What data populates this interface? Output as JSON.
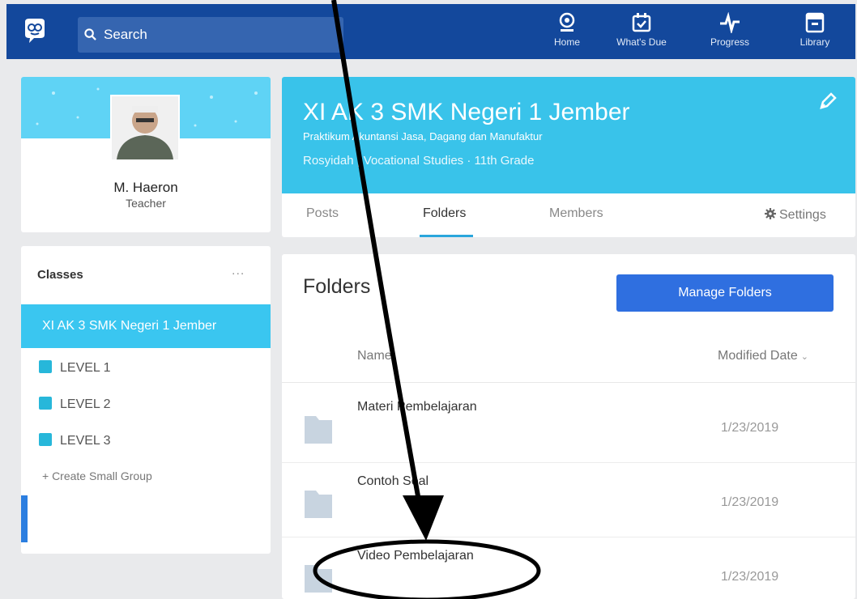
{
  "topbar": {
    "search_placeholder": "Search",
    "nav": [
      {
        "label": "Home",
        "icon": "home-icon"
      },
      {
        "label": "What's Due",
        "icon": "calendar-icon"
      },
      {
        "label": "Progress",
        "icon": "pulse-icon"
      },
      {
        "label": "Library",
        "icon": "library-icon"
      }
    ],
    "bar_color": "#13489c"
  },
  "profile": {
    "name": "M. Haeron",
    "role": "Teacher"
  },
  "classes": {
    "title": "Classes",
    "more": "...",
    "active_class": "XI AK 3 SMK Negeri 1 Jember",
    "groups": [
      "LEVEL 1",
      "LEVEL 2",
      "LEVEL 3"
    ],
    "create_label": "+ Create Small Group"
  },
  "class_header": {
    "title": "XI AK 3 SMK Negeri 1 Jember",
    "subtitle": "Praktikum Akuntansi Jasa, Dagang dan Manufaktur",
    "meta": "Rosyidah | Vocational Studies · 11th Grade",
    "tabs": [
      "Posts",
      "Folders",
      "Members"
    ],
    "active_tab": "Folders",
    "settings_label": "Settings",
    "banner_color": "#39c3ea"
  },
  "folders": {
    "heading": "Folders",
    "manage_label": "Manage Folders",
    "col_name": "Name",
    "col_date": "Modified Date",
    "rows": [
      {
        "name": "Materi Pembelajaran",
        "date": "1/23/2019"
      },
      {
        "name": "Contoh Soal",
        "date": "1/23/2019"
      },
      {
        "name": "Video Pembelajaran",
        "date": "1/23/2019"
      }
    ]
  }
}
